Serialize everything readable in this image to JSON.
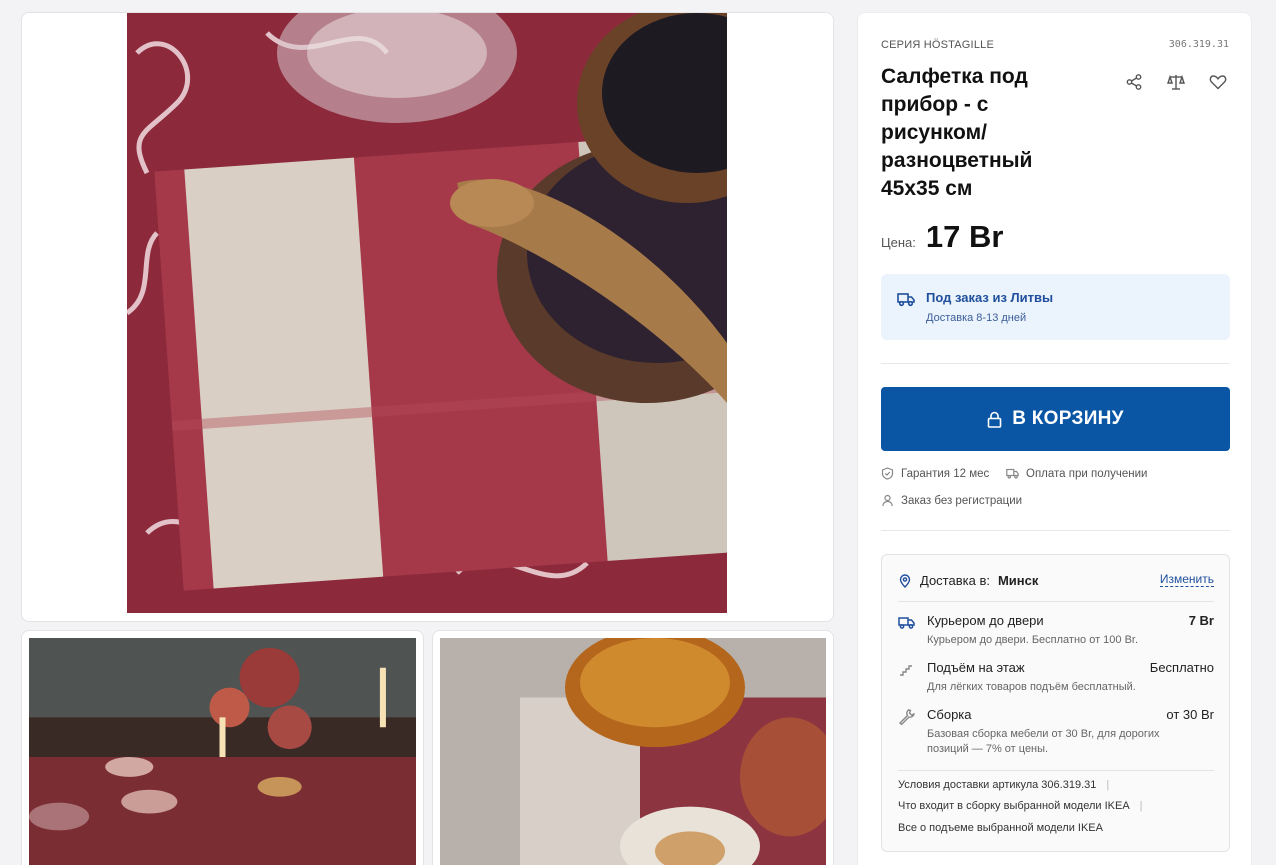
{
  "product": {
    "series": "Серия HÖSTAGILLE",
    "article": "306.319.31",
    "title": "Салфетка под прибор - с рисунком/ разноцветный 45x35 см",
    "price_label": "Цена:",
    "price": "17 Br"
  },
  "actions": {
    "share_icon": "share-icon",
    "compare_icon": "scales-icon",
    "favorite_icon": "heart-icon"
  },
  "order": {
    "title": "Под заказ из Литвы",
    "subtitle": "Доставка 8-13 дней"
  },
  "cart": {
    "label": "В КОРЗИНУ"
  },
  "perks": {
    "warranty": "Гарантия 12 мес",
    "payment": "Оплата при получении",
    "no_registration": "Заказ без регистрации"
  },
  "delivery": {
    "label": "Доставка в:",
    "city": "Минск",
    "change": "Изменить",
    "options": [
      {
        "name": "Курьером до двери",
        "price": "7 Br",
        "desc": "Курьером до двери. Бесплатно от 100 Br."
      },
      {
        "name": "Подъём на этаж",
        "price": "Бесплатно",
        "desc": "Для лёгких товаров подъём бесплатный."
      },
      {
        "name": "Сборка",
        "price": "от 30 Br",
        "desc": "Базовая сборка мебели от 30 Br, для дорогих позиций — 7% от цены."
      }
    ],
    "links": [
      "Условия доставки артикула 306.319.31",
      "Что входит в сборку выбранной модели IKEA",
      "Все о подъеме выбранной модели IKEA"
    ]
  },
  "colors": {
    "accent": "#0a56a5",
    "info_bg": "#ebf3fd",
    "info_text": "#1f4f9c"
  }
}
